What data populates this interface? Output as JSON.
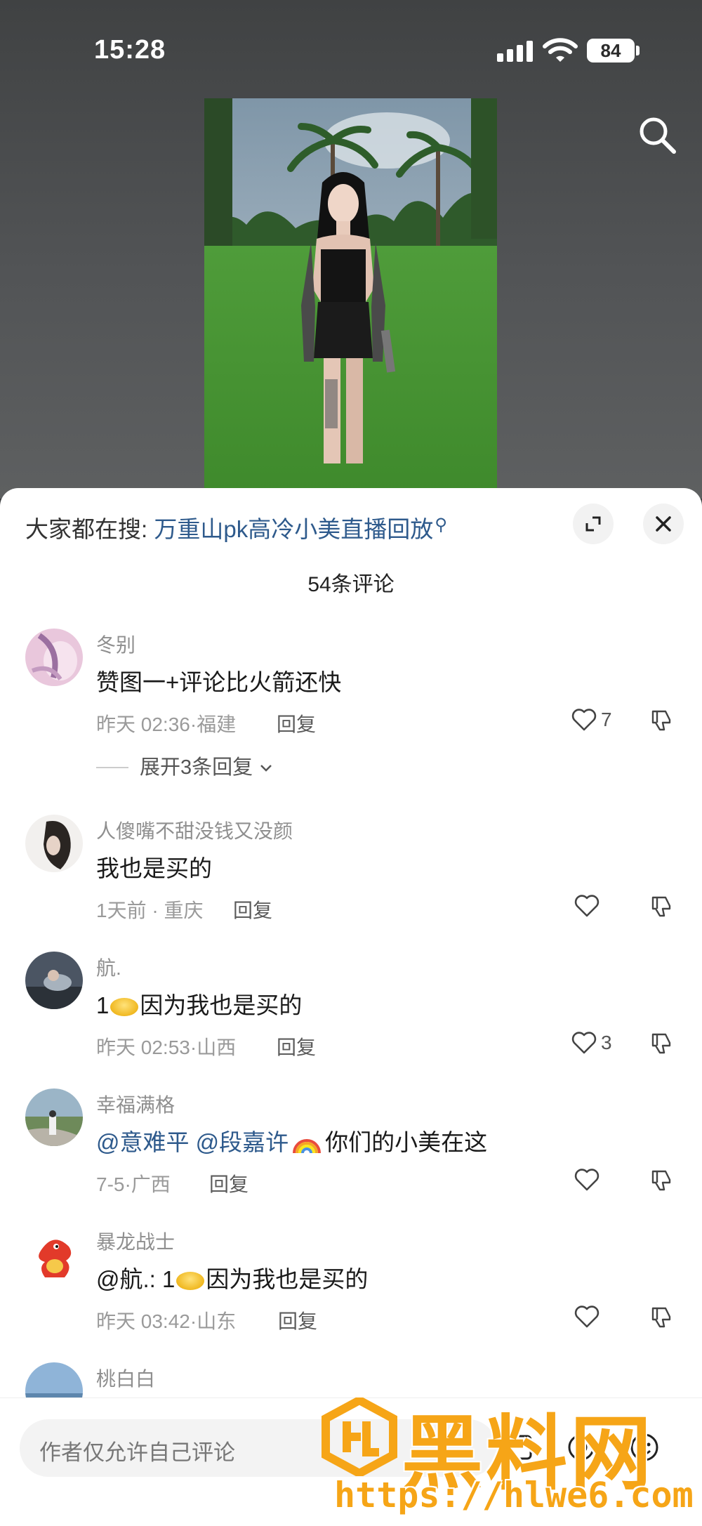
{
  "status_bar": {
    "time": "15:28",
    "battery": "84"
  },
  "sheet": {
    "hot_search_prefix": "大家都在搜:",
    "hot_search_query": "万重山pk高冷小美直播回放",
    "comment_count": "54条评论",
    "reply_label": "回复"
  },
  "comments": [
    {
      "name": "冬别",
      "text": "赞图一+评论比火箭还快",
      "time": "昨天 02:36",
      "location": "福建",
      "likes": "7",
      "expand": "展开3条回复"
    },
    {
      "name": "人傻嘴不甜没钱又没颜",
      "text": "我也是买的",
      "time": "1天前",
      "location": "重庆",
      "likes": ""
    },
    {
      "name": "航.",
      "text_prefix": "1",
      "text": "因为我也是买的",
      "time": "昨天 02:53",
      "location": "山西",
      "likes": "3"
    },
    {
      "name": "幸福满格",
      "mention1": "@意难平",
      "mention2": "@段嘉许",
      "text": "你们的小美在这",
      "time": "7-5",
      "location": "广西",
      "likes": ""
    },
    {
      "name": "暴龙战士",
      "text_prefix": "@航.: 1",
      "text": "因为我也是买的",
      "time": "昨天 03:42",
      "location": "山东",
      "likes": ""
    },
    {
      "name": "桃白白"
    }
  ],
  "input": {
    "placeholder": "作者仅允许自己评论"
  },
  "watermark": {
    "title": "黑料网",
    "url": "https://hlwe6.com"
  },
  "icons": [
    "search-icon",
    "wifi-icon",
    "signal-icon",
    "battery-icon",
    "expand-icon",
    "close-icon",
    "heart-icon",
    "dislike-icon",
    "chevron-down-icon",
    "image-icon",
    "at-icon",
    "emoji-icon"
  ],
  "colors": {
    "link": "#2e5a8c",
    "watermark": "#f6a517"
  }
}
